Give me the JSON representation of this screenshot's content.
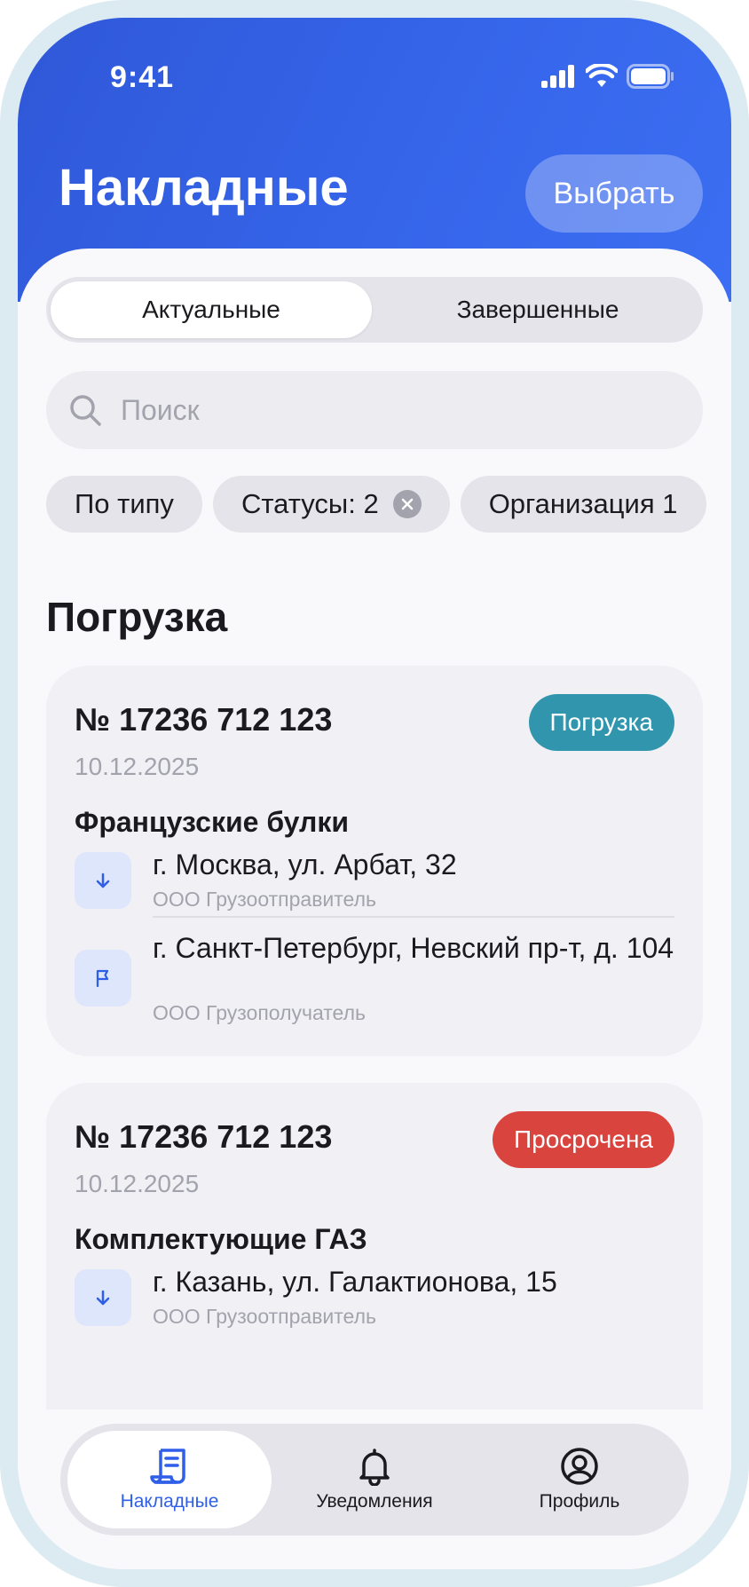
{
  "status_bar": {
    "time": "9:41"
  },
  "header": {
    "title": "Накладные",
    "select_label": "Выбрать"
  },
  "segments": {
    "active": "Актуальные",
    "inactive": "Завершенные"
  },
  "search": {
    "placeholder": "Поиск",
    "value": ""
  },
  "filters": {
    "type": "По типу",
    "statuses": "Статусы: 2",
    "organization": "Организация 1"
  },
  "section": {
    "title": "Погрузка"
  },
  "cards": [
    {
      "number": "№ 17236 712 123",
      "date": "10.12.2025",
      "badge": "Погрузка",
      "badge_color": "#3196ad",
      "cargo": "Французские булки",
      "from": {
        "address": "г. Москва, ул. Арбат, 32",
        "org": "ООО Грузоотправитель"
      },
      "to": {
        "address": "г. Санкт-Петербург, Невский пр-т, д. 104",
        "org": "ООО Грузополучатель"
      }
    },
    {
      "number": "№ 17236 712 123",
      "date": "10.12.2025",
      "badge": "Просрочена",
      "badge_color": "#d9443f",
      "cargo": "Комплектующие ГАЗ",
      "from": {
        "address": "г. Казань, ул. Галактионова, 15",
        "org": "ООО Грузоотправитель"
      }
    }
  ],
  "tabbar": {
    "invoices": "Накладные",
    "notifications": "Уведомления",
    "profile": "Профиль"
  },
  "colors": {
    "accent": "#2f5fe8",
    "header_gradient_start": "#2f58d8",
    "header_gradient_end": "#3b6ef2"
  }
}
